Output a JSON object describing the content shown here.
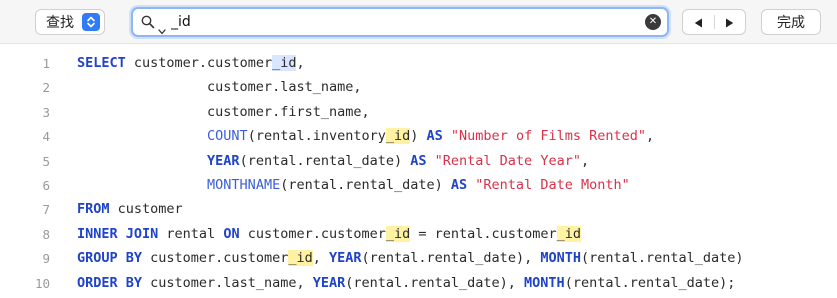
{
  "find_bar": {
    "mode_label": "查找",
    "search_value": "_id",
    "done_label": "完成"
  },
  "code_lines": [
    {
      "num": "1",
      "segments": [
        {
          "t": "SELECT",
          "c": "kw"
        },
        {
          "t": " customer.customer",
          "c": ""
        },
        {
          "t": "_id",
          "c": "hl-cur"
        },
        {
          "t": ",",
          "c": ""
        }
      ]
    },
    {
      "num": "2",
      "segments": [
        {
          "t": "                customer.last_name,",
          "c": ""
        }
      ]
    },
    {
      "num": "3",
      "segments": [
        {
          "t": "                customer.first_name,",
          "c": ""
        }
      ]
    },
    {
      "num": "4",
      "segments": [
        {
          "t": "                ",
          "c": ""
        },
        {
          "t": "COUNT",
          "c": "fn"
        },
        {
          "t": "(rental.inventory",
          "c": ""
        },
        {
          "t": "_id",
          "c": "hl"
        },
        {
          "t": ") ",
          "c": ""
        },
        {
          "t": "AS",
          "c": "kw"
        },
        {
          "t": " ",
          "c": ""
        },
        {
          "t": "\"Number of Films Rented\"",
          "c": "str"
        },
        {
          "t": ",",
          "c": ""
        }
      ]
    },
    {
      "num": "5",
      "segments": [
        {
          "t": "                ",
          "c": ""
        },
        {
          "t": "YEAR",
          "c": "kw"
        },
        {
          "t": "(rental.rental_date) ",
          "c": ""
        },
        {
          "t": "AS",
          "c": "kw"
        },
        {
          "t": " ",
          "c": ""
        },
        {
          "t": "\"Rental Date Year\"",
          "c": "str"
        },
        {
          "t": ",",
          "c": ""
        }
      ]
    },
    {
      "num": "6",
      "segments": [
        {
          "t": "                ",
          "c": ""
        },
        {
          "t": "MONTHNAME",
          "c": "fn"
        },
        {
          "t": "(rental.rental_date) ",
          "c": ""
        },
        {
          "t": "AS",
          "c": "kw"
        },
        {
          "t": " ",
          "c": ""
        },
        {
          "t": "\"Rental Date Month\"",
          "c": "str"
        }
      ]
    },
    {
      "num": "7",
      "segments": [
        {
          "t": "FROM",
          "c": "kw"
        },
        {
          "t": " customer",
          "c": ""
        }
      ]
    },
    {
      "num": "8",
      "segments": [
        {
          "t": "INNER JOIN",
          "c": "kw"
        },
        {
          "t": " rental ",
          "c": ""
        },
        {
          "t": "ON",
          "c": "kw"
        },
        {
          "t": " customer.customer",
          "c": ""
        },
        {
          "t": "_id",
          "c": "hl"
        },
        {
          "t": " = rental.customer",
          "c": ""
        },
        {
          "t": "_id",
          "c": "hl"
        }
      ]
    },
    {
      "num": "9",
      "segments": [
        {
          "t": "GROUP BY",
          "c": "kw"
        },
        {
          "t": " customer.customer",
          "c": ""
        },
        {
          "t": "_id",
          "c": "hl"
        },
        {
          "t": ", ",
          "c": ""
        },
        {
          "t": "YEAR",
          "c": "kw"
        },
        {
          "t": "(rental.rental_date), ",
          "c": ""
        },
        {
          "t": "MONTH",
          "c": "kw"
        },
        {
          "t": "(rental.rental_date)",
          "c": ""
        }
      ]
    },
    {
      "num": "10",
      "segments": [
        {
          "t": "ORDER BY",
          "c": "kw"
        },
        {
          "t": " customer.last_name, ",
          "c": ""
        },
        {
          "t": "YEAR",
          "c": "kw"
        },
        {
          "t": "(rental.rental_date), ",
          "c": ""
        },
        {
          "t": "MONTH",
          "c": "kw"
        },
        {
          "t": "(rental.rental_date);",
          "c": ""
        }
      ]
    }
  ],
  "colors": {
    "keyword": "#1f43c9",
    "function": "#3a5fd9",
    "string": "#d8324a",
    "match_highlight": "#fff3a3",
    "current_match": "#d9e6ff",
    "accent": "#2f7cf6"
  },
  "icons": {
    "mode_stepper": "chevron-updown-icon",
    "search": "magnifier-icon",
    "search_options": "chevron-down-icon",
    "clear": "clear-icon",
    "previous": "previous-match-icon",
    "next": "next-match-icon"
  }
}
